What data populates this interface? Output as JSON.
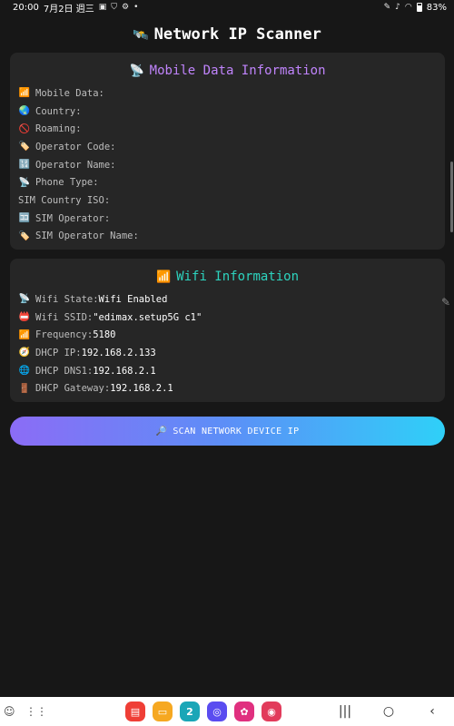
{
  "status_bar": {
    "time": "20:00",
    "date": "7月2日 週三",
    "battery": "83%"
  },
  "app": {
    "title_icon": "🛰️",
    "title": "Network IP Scanner"
  },
  "mobile_card": {
    "icon": "📡",
    "title": "Mobile Data Information",
    "rows": [
      {
        "icon": "📶",
        "label": "Mobile Data:",
        "value": ""
      },
      {
        "icon": "🌏",
        "label": "Country:",
        "value": ""
      },
      {
        "icon": "🚫",
        "label": "Roaming:",
        "value": ""
      },
      {
        "icon": "🏷️",
        "label": "Operator Code:",
        "value": ""
      },
      {
        "icon": "🔢",
        "label": "Operator Name:",
        "value": ""
      },
      {
        "icon": "📡",
        "label": "Phone Type:",
        "value": ""
      },
      {
        "icon": "",
        "label": "SIM Country ISO:",
        "value": ""
      },
      {
        "icon": "🈁",
        "label": "SIM Operator:",
        "value": ""
      },
      {
        "icon": "🏷️",
        "label": "SIM Operator Name:",
        "value": ""
      }
    ]
  },
  "wifi_card": {
    "icon": "📶",
    "title": "Wifi Information",
    "rows": [
      {
        "icon": "📡",
        "label": "Wifi State:",
        "value": "Wifi Enabled"
      },
      {
        "icon": "📛",
        "label": "Wifi SSID:",
        "value": "\"edimax.setup5G c1\""
      },
      {
        "icon": "📶",
        "label": "Frequency:",
        "value": "5180"
      },
      {
        "icon": "🧭",
        "label": "DHCP IP:",
        "value": "192.168.2.133"
      },
      {
        "icon": "🌐",
        "label": "DHCP DNS1:",
        "value": "192.168.2.1"
      },
      {
        "icon": "🚪",
        "label": "DHCP Gateway:",
        "value": "192.168.2.1"
      }
    ]
  },
  "scan_button": {
    "icon": "🔎",
    "label": "SCAN NETWORK DEVICE IP"
  },
  "nav_bar": {
    "dock_apps": [
      {
        "name": "Notes",
        "color": "#ef3e36",
        "glyph": "▤"
      },
      {
        "name": "Folder",
        "color": "#f6a821",
        "glyph": "▭"
      },
      {
        "name": "Calendar",
        "color": "#1aa6b7",
        "glyph": "2"
      },
      {
        "name": "Internet",
        "color": "#5a4cf0",
        "glyph": "◎"
      },
      {
        "name": "Gallery",
        "color": "#e0307f",
        "glyph": "✿"
      },
      {
        "name": "Screen Recorder",
        "color": "#e23b5b",
        "glyph": "◉"
      }
    ]
  }
}
